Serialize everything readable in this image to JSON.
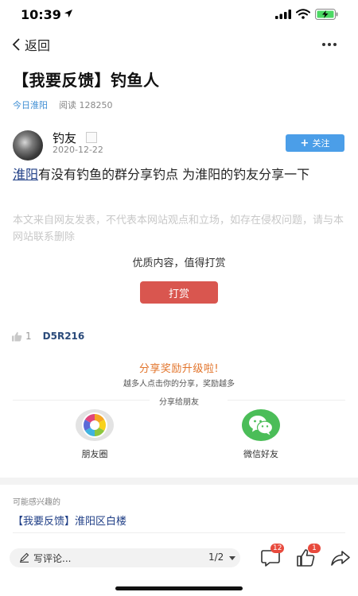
{
  "status": {
    "time": "10:39",
    "icons": [
      "location-arrow-icon",
      "signal-icon",
      "wifi-icon",
      "battery-charging-icon"
    ]
  },
  "nav": {
    "back_label": "返回",
    "more_icon": "more-dots-icon"
  },
  "article": {
    "title": "【我要反馈】钓鱼人",
    "source": "今日淮阳",
    "reads": "阅读 128250",
    "author": {
      "name": "钓友",
      "date": "2020-12-22"
    },
    "follow_label": "关注",
    "body_link": "淮阳",
    "body_text": "有没有钓鱼的群分享钓点  为淮阳的钓友分享一下",
    "disclaimer": "本文来自网友发表，不代表本网站观点和立场，如存在侵权问题，请与本网站联系删除",
    "reward_prompt": "优质内容，值得打赏",
    "reward_button": "打赏",
    "like_count": "1",
    "like_code": "D5R216"
  },
  "share": {
    "title": "分享奖励升级啦!",
    "subtitle": "越多人点击你的分享，奖励越多",
    "divider_text": "分享给朋友",
    "targets": [
      {
        "label": "朋友圈",
        "icon": "wechat-moments-icon"
      },
      {
        "label": "微信好友",
        "icon": "wechat-icon"
      }
    ]
  },
  "related": {
    "label": "可能感兴趣的",
    "items": [
      "【我要反馈】淮阳区白楼"
    ]
  },
  "bottom_bar": {
    "comment_placeholder": "写评论...",
    "pager": "1/2",
    "comment_badge": "12",
    "like_badge": "1"
  },
  "colors": {
    "accent_blue": "#4b9ee8",
    "source_blue": "#3d8dd3",
    "link_navy": "#1f3e86",
    "reward_red": "#d9564f",
    "share_orange": "#e2742b",
    "badge_red": "#e84a3d",
    "wechat_green": "#4bbd58"
  }
}
